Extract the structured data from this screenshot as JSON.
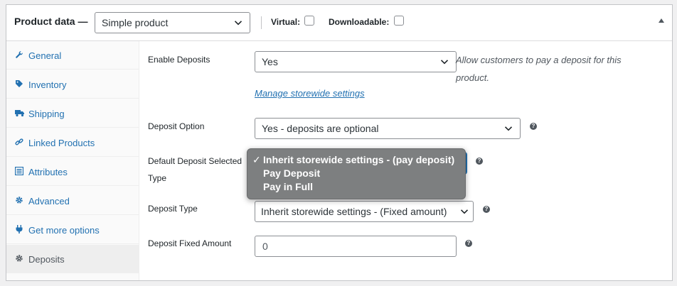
{
  "header": {
    "title": "Product data —",
    "product_type": "Simple product",
    "virtual_label": "Virtual:",
    "downloadable_label": "Downloadable:"
  },
  "sidebar": {
    "items": [
      {
        "label": "General",
        "icon": "wrench-icon"
      },
      {
        "label": "Inventory",
        "icon": "tag-icon"
      },
      {
        "label": "Shipping",
        "icon": "truck-icon"
      },
      {
        "label": "Linked Products",
        "icon": "link-icon"
      },
      {
        "label": "Attributes",
        "icon": "list-icon"
      },
      {
        "label": "Advanced",
        "icon": "gear-icon"
      },
      {
        "label": "Get more options",
        "icon": "plugin-icon"
      },
      {
        "label": "Deposits",
        "icon": "gear-icon"
      }
    ],
    "active": "Deposits"
  },
  "fields": {
    "enable_deposits": {
      "label": "Enable Deposits",
      "value": "Yes",
      "description": "Allow customers to pay a deposit for this product."
    },
    "manage_link": "Manage storewide settings",
    "deposit_option": {
      "label": "Deposit Option",
      "value": "Yes - deposits are optional"
    },
    "default_selected_type": {
      "label_line1": "Default Deposit Selected",
      "label_line2": "Type",
      "value": "Inherit storewide settings - (pay deposit)",
      "options": [
        "Inherit storewide settings - (pay deposit)",
        "Pay Deposit",
        "Pay in Full"
      ],
      "check_mark": "✓"
    },
    "deposit_type": {
      "label": "Deposit Type",
      "value": "Inherit storewide settings - (Fixed amount)"
    },
    "deposit_fixed_amount": {
      "label": "Deposit Fixed Amount",
      "value": "0"
    },
    "help_glyph": "?"
  },
  "colors": {
    "link": "#2271b1",
    "dropdown_bg": "#7d7f80",
    "focus": "#2271b1"
  }
}
